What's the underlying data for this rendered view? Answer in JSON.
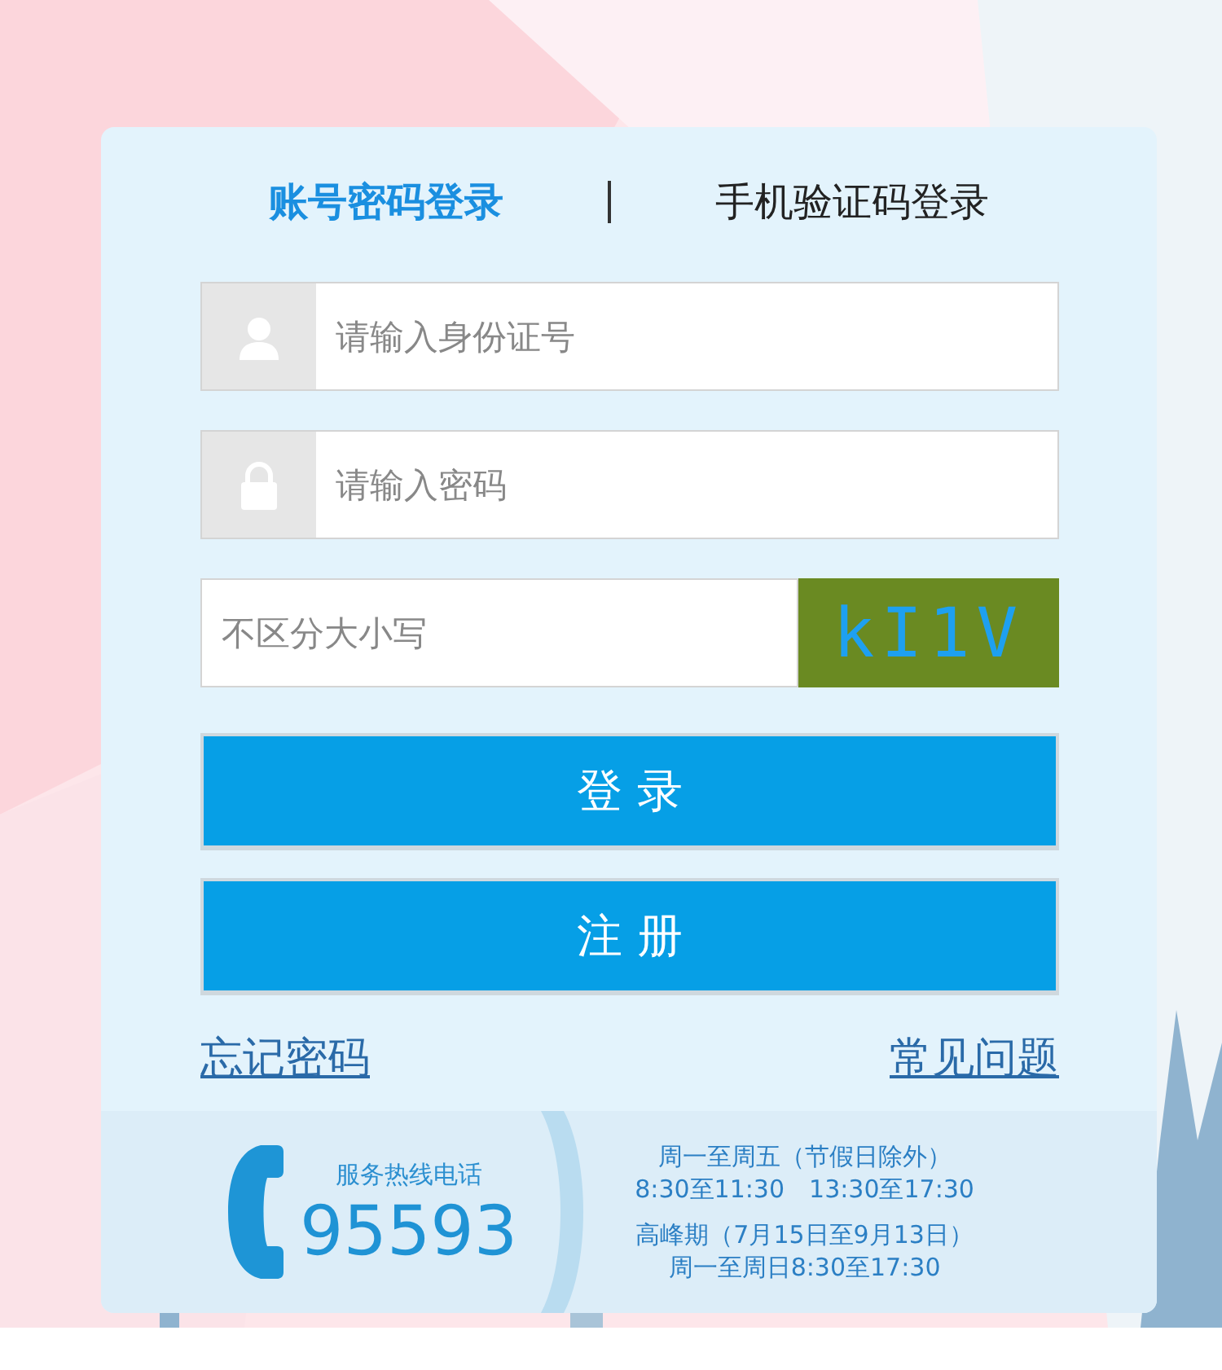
{
  "tabs": [
    {
      "label": "账号密码登录",
      "selected": true
    },
    {
      "label": "手机验证码登录",
      "selected": false
    }
  ],
  "fields": [
    {
      "kind": "user",
      "placeholder": "请输入身份证号"
    },
    {
      "kind": "lock",
      "placeholder": "请输入密码"
    }
  ],
  "captcha": {
    "placeholder": "不区分大小写",
    "code": "kI1V"
  },
  "buttons": [
    "登 录",
    "注 册"
  ],
  "links": [
    "忘记密码",
    "常见问题"
  ],
  "hotline": {
    "label": "服务热线电话",
    "number": "95593",
    "hours": [
      "周一至周五（节假日除外）",
      "8:30至11:30　13:30至17:30",
      "高峰期（7月15日至9月13日）",
      "周一至周日8:30至17:30"
    ]
  }
}
